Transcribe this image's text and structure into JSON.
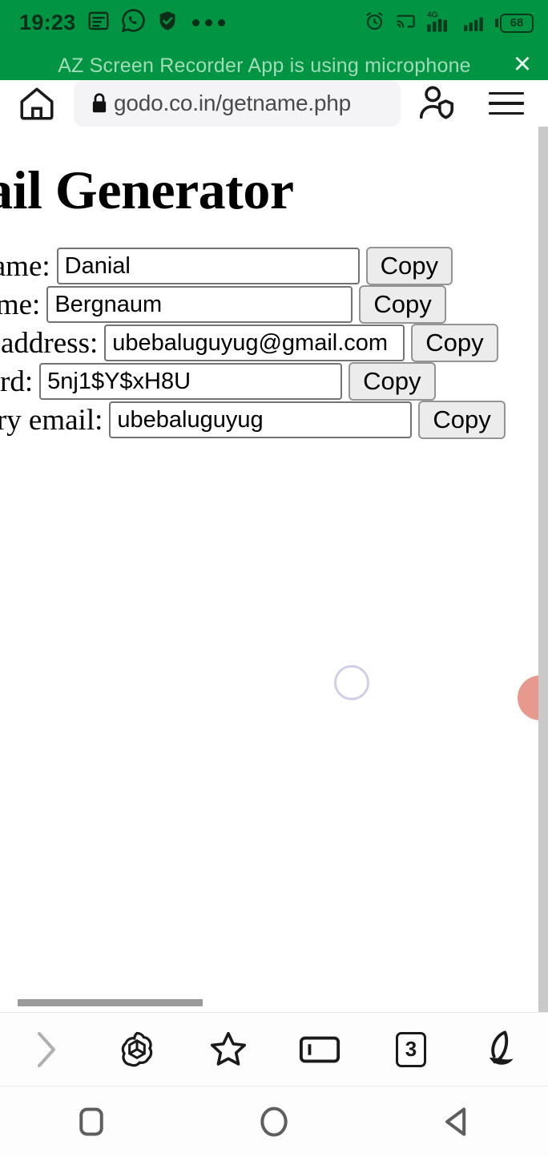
{
  "status_bar": {
    "time": "19:23",
    "left_icons": [
      "subtitles-icon",
      "whatsapp-icon",
      "shield-icon",
      "more-dots-icon"
    ],
    "right_icons": [
      "alarm-icon",
      "cast-icon",
      "signal-4g-icon",
      "signal-icon"
    ],
    "network_label": "4G",
    "battery_level": "68",
    "background_color": "#019443"
  },
  "notification": {
    "message": "AZ Screen Recorder App is using microphone",
    "close_label": "×"
  },
  "browser": {
    "url": "godo.co.in/getname.php",
    "home_icon": "home-icon",
    "lock_icon": "lock-icon",
    "profile_icon": "profile-shield-icon",
    "menu_icon": "hamburger-menu-icon"
  },
  "page": {
    "title": "mail Generator",
    "fields": [
      {
        "label": "rst name:",
        "value": "Danial",
        "copy_label": "Copy"
      },
      {
        "label": "st name:",
        "value": "Bergnaum",
        "copy_label": "Copy"
      },
      {
        "label": "mail address:",
        "value": "ubebaluguyug@gmail.com",
        "copy_label": "Copy"
      },
      {
        "label": "ssword:",
        "value": "5nj1$Y$xH8U",
        "copy_label": "Copy"
      },
      {
        "label": "covery email:",
        "value": "ubebaluguyug",
        "copy_label": "Copy"
      }
    ],
    "spinner": "loading-spinner",
    "floating_button": "floating-action-button",
    "floating_button_color": "#e8998d"
  },
  "bottom_toolbar": {
    "items": [
      {
        "name": "forward-arrow-icon",
        "label": ""
      },
      {
        "name": "openai-logo-icon",
        "label": ""
      },
      {
        "name": "star-bookmark-icon",
        "label": ""
      },
      {
        "name": "address-bar-icon",
        "label": ""
      },
      {
        "name": "tab-counter-icon",
        "label": "3"
      },
      {
        "name": "opera-shell-icon",
        "label": ""
      }
    ],
    "tab_count": "3"
  },
  "nav_bar": {
    "items": [
      "recents-square-icon",
      "home-circle-icon",
      "back-triangle-icon"
    ]
  }
}
